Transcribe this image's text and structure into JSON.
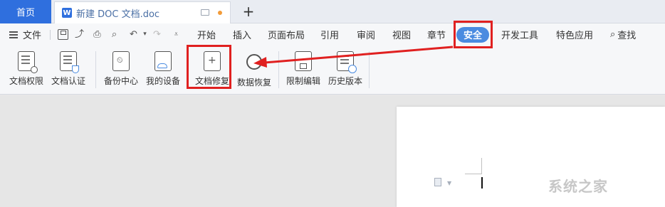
{
  "tabs": {
    "home": "首页",
    "doc_title": "新建 DOC 文档.doc",
    "wps_letter": "W",
    "add": "+"
  },
  "menubar": {
    "file": "文件",
    "items": [
      "开始",
      "插入",
      "页面布局",
      "引用",
      "审阅",
      "视图",
      "章节",
      "安全",
      "开发工具",
      "特色应用"
    ],
    "search": "查找"
  },
  "ribbon": {
    "buttons": [
      "文档权限",
      "文档认证",
      "备份中心",
      "我的设备",
      "文档修复",
      "数据恢复",
      "限制编辑",
      "历史版本"
    ]
  },
  "watermark": "系统之家",
  "colors": {
    "accent": "#2f6fde",
    "highlight_red": "#e02020",
    "pill": "#4a8be0"
  }
}
